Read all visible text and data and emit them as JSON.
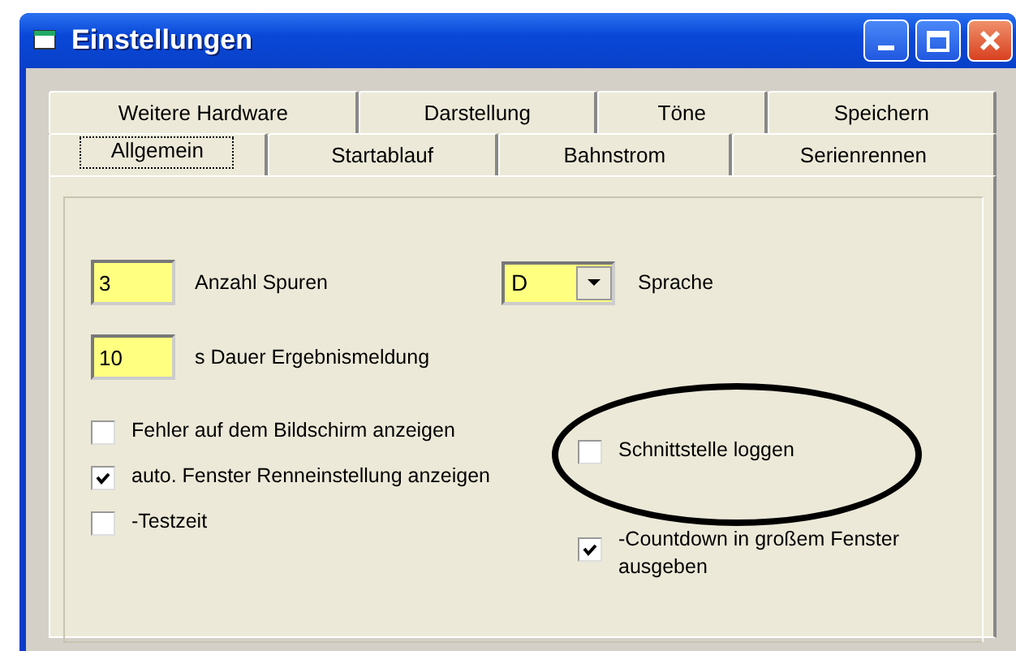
{
  "window": {
    "title": "Einstellungen"
  },
  "tab_rows": [
    {
      "tabs": [
        {
          "label": "Weitere Hardware",
          "selected": false
        },
        {
          "label": "Darstellung",
          "selected": false
        },
        {
          "label": "Töne",
          "selected": false
        },
        {
          "label": "Speichern",
          "selected": false
        }
      ]
    },
    {
      "tabs": [
        {
          "label": "Allgemein",
          "selected": true
        },
        {
          "label": "Startablauf",
          "selected": false
        },
        {
          "label": "Bahnstrom",
          "selected": false
        },
        {
          "label": "Serienrennen",
          "selected": false
        }
      ]
    }
  ],
  "fields": [
    {
      "value": "3",
      "label": "Anzahl Spuren"
    },
    {
      "value": "10",
      "label": "s Dauer Ergebnismeldung"
    }
  ],
  "language": {
    "value": "D",
    "label": "Sprache"
  },
  "checkboxes_left": [
    {
      "label": "Fehler auf dem Bildschirm anzeigen",
      "checked": false
    },
    {
      "label": "auto. Fenster Renneinstellung anzeigen",
      "checked": true
    },
    {
      "label": "-Testzeit",
      "checked": false
    }
  ],
  "checkboxes_right": [
    {
      "label": "Schnittstelle loggen",
      "checked": false,
      "circled": true
    },
    {
      "label": "-Countdown in großem Fenster ausgeben",
      "checked": true,
      "circled": false
    }
  ]
}
